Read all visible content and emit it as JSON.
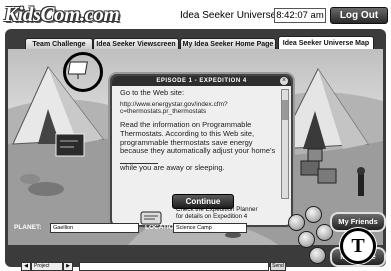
{
  "header": {
    "logo_text": "KidsCom.com",
    "time_label": "Idea Seeker Universe Time:",
    "time_value": "8:42:07 am",
    "logout_label": "Log Out"
  },
  "tabs": [
    {
      "label": "Team Challenge"
    },
    {
      "label": "Idea Seeker Viewscreen"
    },
    {
      "label": "My Idea Seeker Home Page"
    },
    {
      "label": "Idea Seeker Universe Map"
    }
  ],
  "dialog": {
    "title": "EPISODE 1 - EXPEDITION 4",
    "close_symbol": "×",
    "line1": "Go to the Web site:",
    "url": "http://www.energystar.gov/index.cfm?c=thermostats.pr_thermostats",
    "paragraph": "Read the information on Programmable Thermostats. According to this Web site, programmable thermostats save energy because they automatically adjust your home's",
    "paragraph_end": "while you are away or sleeping.",
    "continue_label": "Continue"
  },
  "planner": {
    "text": "Check the Expedition Planner for details on Expedition 4"
  },
  "status": {
    "planet_label": "PLANET:",
    "planet_value": "Gaellion",
    "location_label": "LOCATION:",
    "location_value": "Science Camp"
  },
  "chat": {
    "left_arrow": "◀",
    "select_value": "Project",
    "right_arrow": "▶",
    "send_label": "Send"
  },
  "side_buttons": {
    "friends": "My Friends",
    "house": "My House"
  },
  "watermark": {
    "letter": "T"
  }
}
